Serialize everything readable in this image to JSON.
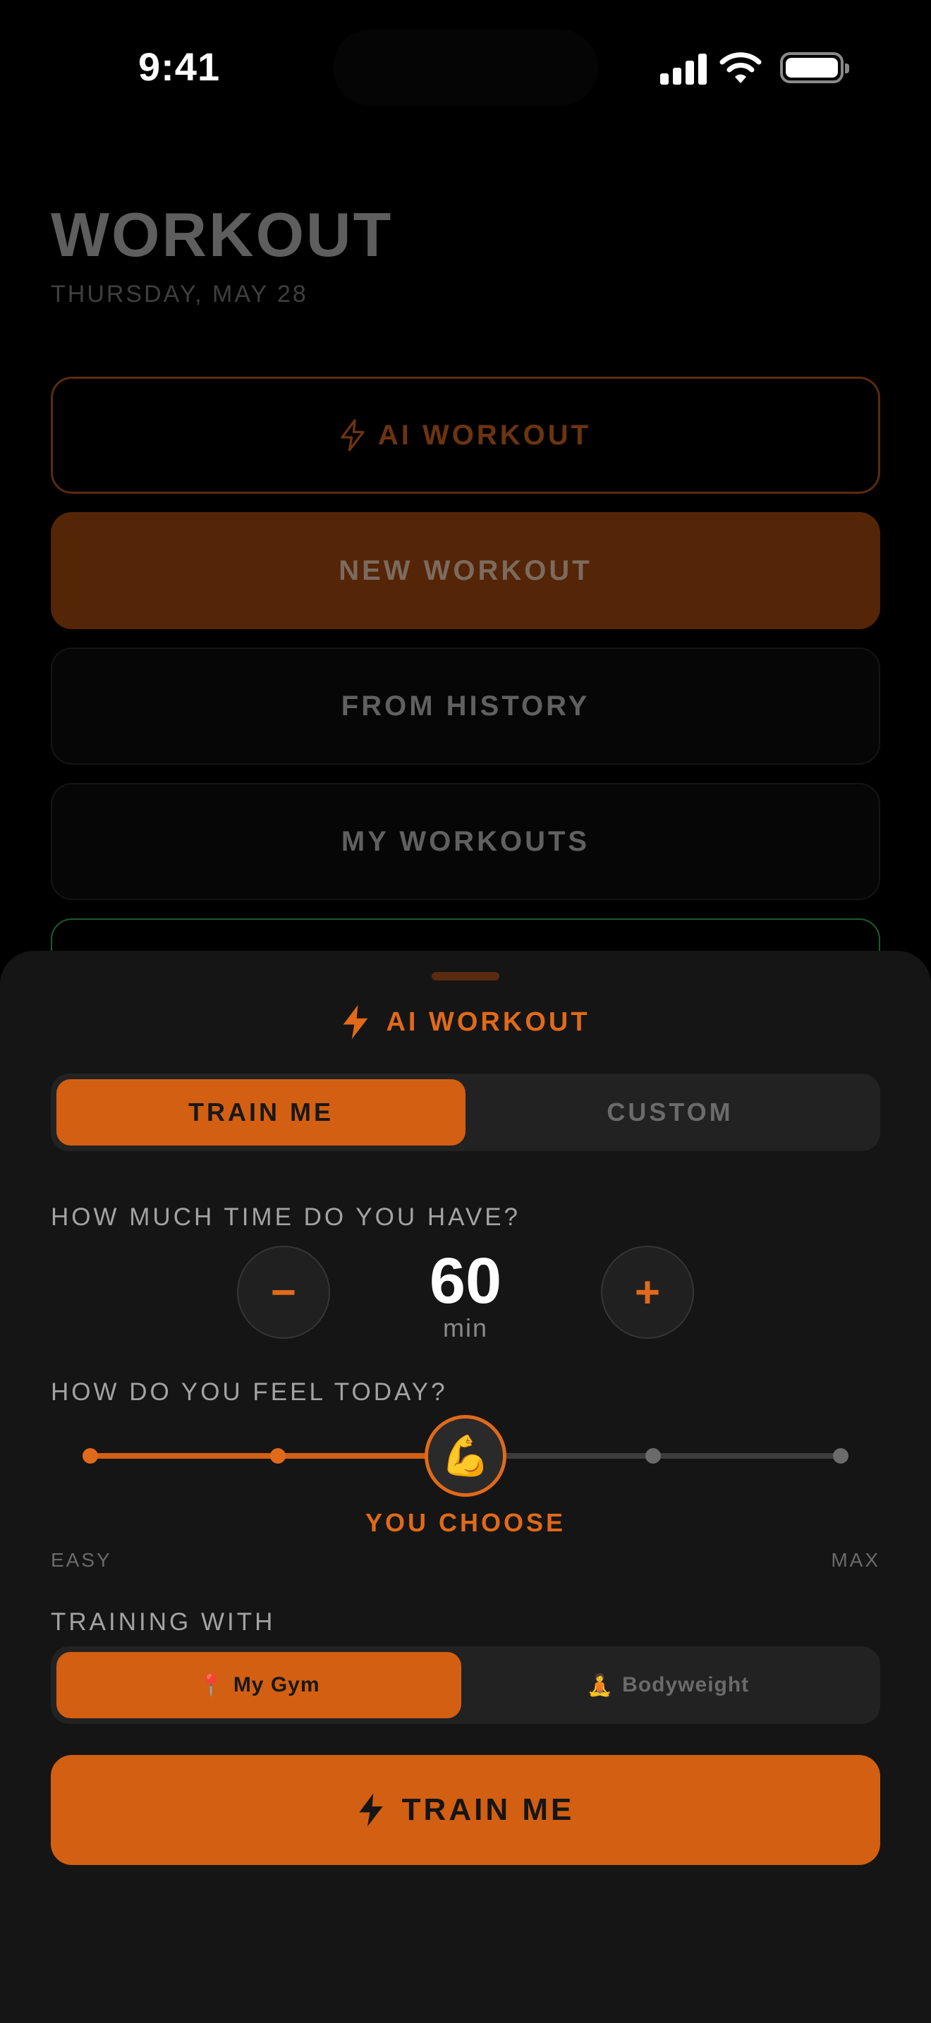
{
  "status_bar": {
    "time": "9:41"
  },
  "page": {
    "title": "WORKOUT",
    "date": "THURSDAY, MAY 28",
    "buttons": {
      "ai_workout": "AI WORKOUT",
      "new_workout": "NEW WORKOUT",
      "from_history": "FROM HISTORY",
      "my_workouts": "MY WORKOUTS"
    }
  },
  "sheet": {
    "title": "AI WORKOUT",
    "mode": {
      "options": [
        "TRAIN ME",
        "CUSTOM"
      ],
      "selected": "TRAIN ME"
    },
    "time": {
      "question": "HOW MUCH TIME DO YOU HAVE?",
      "minus": "−",
      "plus": "+",
      "value": "60",
      "unit": "min"
    },
    "feel": {
      "question": "HOW DO YOU FEEL TODAY?",
      "levels": 5,
      "selected_index": 2,
      "selected_emoji": "💪",
      "selected_label": "YOU CHOOSE",
      "min_label": "EASY",
      "max_label": "MAX"
    },
    "training_with": {
      "question": "TRAINING WITH",
      "options": [
        {
          "icon": "📍",
          "label": "My Gym"
        },
        {
          "icon": "🧘",
          "label": "Bodyweight"
        }
      ],
      "selected": "My Gym"
    },
    "cta_label": "TRAIN ME"
  },
  "colors": {
    "accent": "#d35f12",
    "accent_text": "#e06a1a",
    "sheet_bg": "#151515",
    "background": "#000000"
  }
}
